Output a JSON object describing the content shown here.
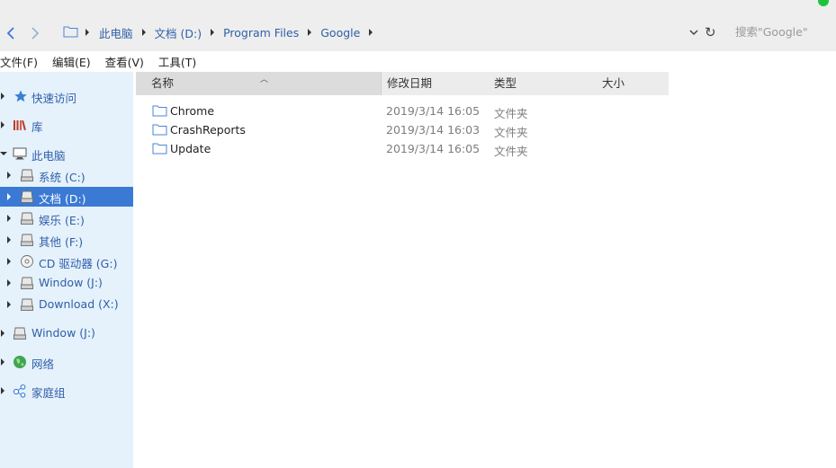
{
  "address_bar": {
    "breadcrumbs": [
      "此电脑",
      "文档 (D:)",
      "Program Files",
      "Google"
    ],
    "search_placeholder": "搜索\"Google\"",
    "refresh_glyph": "↻"
  },
  "menu": [
    "文件(F)",
    "编辑(E)",
    "查看(V)",
    "工具(T)"
  ],
  "sidebar": {
    "items": [
      {
        "label": "快速访问",
        "icon": "star-icon"
      },
      {
        "label": "库",
        "icon": "library-icon"
      },
      {
        "label": "此电脑",
        "icon": "computer-icon",
        "expanded": true
      },
      {
        "label": "系统 (C:)",
        "icon": "drive-icon"
      },
      {
        "label": "文档 (D:)",
        "icon": "drive-icon",
        "selected": true
      },
      {
        "label": "娱乐 (E:)",
        "icon": "drive-icon"
      },
      {
        "label": "其他 (F:)",
        "icon": "drive-icon"
      },
      {
        "label": "CD 驱动器 (G:)",
        "icon": "cd-drive-icon"
      },
      {
        "label": "Window (J:)",
        "icon": "drive-icon"
      },
      {
        "label": "Download (X:)",
        "icon": "drive-icon"
      },
      {
        "label": "Window (J:)",
        "icon": "drive-icon"
      },
      {
        "label": "网络",
        "icon": "network-icon"
      },
      {
        "label": "家庭组",
        "icon": "homegroup-icon"
      }
    ]
  },
  "columns": {
    "name": "名称",
    "date": "修改日期",
    "type": "类型",
    "size": "大小"
  },
  "files": [
    {
      "name": "Chrome",
      "date": "2019/3/14 16:05",
      "type": "文件夹",
      "size": ""
    },
    {
      "name": "CrashReports",
      "date": "2019/3/14 16:03",
      "type": "文件夹",
      "size": ""
    },
    {
      "name": "Update",
      "date": "2019/3/14 16:05",
      "type": "文件夹",
      "size": ""
    }
  ],
  "colors": {
    "accent": "#3b7ad4",
    "link": "#2f5fa8",
    "sidebar_bg": "#e5f1fb",
    "status_dot": "#1fc33b"
  }
}
